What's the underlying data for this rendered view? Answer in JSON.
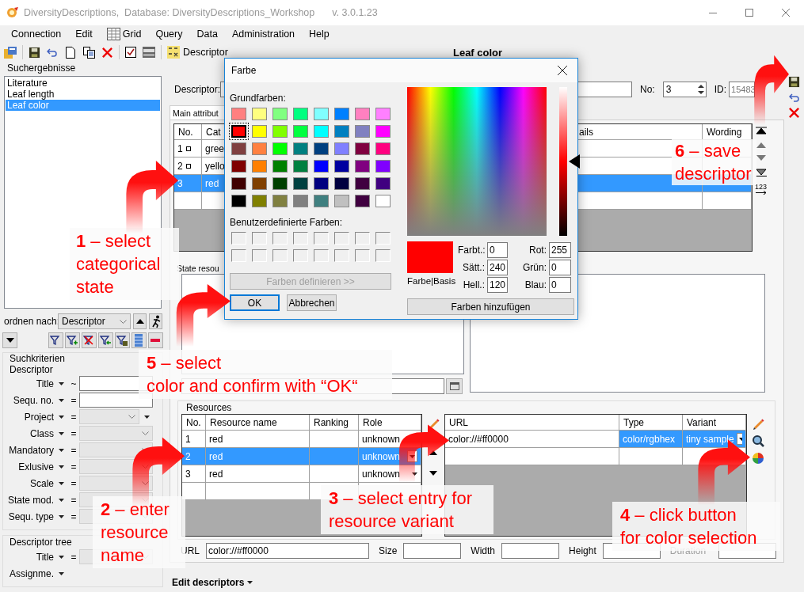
{
  "window": {
    "title": "DiversityDescriptions,  Database: DiversityDescriptions_Workshop",
    "version": "v. 3.0.1.23"
  },
  "menu": [
    {
      "label": "Connection",
      "kind": "plain"
    },
    {
      "label": "Edit",
      "kind": "plain"
    },
    {
      "label": "Grid",
      "kind": "grid"
    },
    {
      "label": "Query",
      "kind": "plain"
    },
    {
      "label": "Data",
      "kind": "plain"
    },
    {
      "label": "Administration",
      "kind": "plain"
    },
    {
      "label": "Help",
      "kind": "plain"
    }
  ],
  "toolbar": {
    "descriptor_button": "Descriptor"
  },
  "page_title": "Leaf color",
  "search_results": {
    "title": "Suchergebnisse",
    "items": [
      {
        "label": "Literature",
        "selected": false
      },
      {
        "label": "Leaf length",
        "selected": false
      },
      {
        "label": "Leaf color",
        "selected": true
      }
    ]
  },
  "sort": {
    "label": "ordnen nach:",
    "value": "Descriptor"
  },
  "search_criteria": {
    "title": "Suchkriterien",
    "group": "Descriptor",
    "rows": [
      {
        "label": "Title",
        "operator": "~",
        "kind": "text"
      },
      {
        "label": "Sequ. no.",
        "operator": "=",
        "kind": "text"
      },
      {
        "label": "Project",
        "operator": "=",
        "kind": "combo-extra"
      },
      {
        "label": "Class",
        "operator": "=",
        "kind": "combo"
      },
      {
        "label": "Mandatory",
        "operator": "=",
        "kind": "combo"
      },
      {
        "label": "Exlusive",
        "operator": "=",
        "kind": "combo"
      },
      {
        "label": "Scale",
        "operator": "=",
        "kind": "combo"
      },
      {
        "label": "State mod.",
        "operator": "=",
        "kind": "combo"
      },
      {
        "label": "Sequ. type",
        "operator": "=",
        "kind": "combo"
      }
    ]
  },
  "descriptor_tree": {
    "title": "Descriptor tree",
    "rows": [
      {
        "label": "Title",
        "operator": "=",
        "kind": "combo"
      },
      {
        "label": "Assignme.",
        "kind": "none"
      }
    ]
  },
  "descriptor": {
    "label": "Descriptor:",
    "no_label": "No:",
    "no": "3",
    "id_label": "ID:",
    "id": "15483"
  },
  "main_tab": {
    "label": "Main attribut",
    "columns": [
      "No.",
      "Cat",
      "ails",
      "Wording"
    ],
    "renumber": "123",
    "rows": [
      {
        "no": "1",
        "marker": true,
        "category": "gree",
        "selected": false
      },
      {
        "no": "2",
        "marker": true,
        "category": "yello",
        "selected": false
      },
      {
        "no": "3",
        "marker": false,
        "category": "red",
        "selected": true
      }
    ]
  },
  "state_resources": {
    "label": "State resou"
  },
  "resources": {
    "title": "Resources",
    "columns": [
      "No.",
      "Resource name",
      "Ranking",
      "Role"
    ],
    "rows": [
      {
        "no": "1",
        "name": "red",
        "role": "unknown",
        "selected": false
      },
      {
        "no": "2",
        "name": "red",
        "role": "unknown",
        "selected": true
      },
      {
        "no": "3",
        "name": "red",
        "role": "unknown",
        "selected": false
      }
    ]
  },
  "variants": {
    "columns": [
      "URL",
      "Type",
      "Variant"
    ],
    "rows": [
      {
        "url": "color://#ff0000",
        "type": "color/rgbhex",
        "variant": "tiny sample",
        "selected": true
      }
    ]
  },
  "details": [
    {
      "label": "URL",
      "value": "color://#ff0000",
      "disabled": false
    },
    {
      "label": "Size",
      "disabled": false
    },
    {
      "label": "Width",
      "disabled": false
    },
    {
      "label": "Height",
      "disabled": false
    },
    {
      "label": "Duration",
      "disabled": true
    }
  ],
  "bottom_tab": {
    "label": "Edit descriptors"
  },
  "color_dialog": {
    "title": "Farbe",
    "basic_label": "Grundfarben:",
    "basic_colors": [
      {
        "color": "#ff8080",
        "selected": false
      },
      {
        "color": "#ffff80",
        "selected": false
      },
      {
        "color": "#80ff80",
        "selected": false
      },
      {
        "color": "#00ff80",
        "selected": false
      },
      {
        "color": "#80ffff",
        "selected": false
      },
      {
        "color": "#0080ff",
        "selected": false
      },
      {
        "color": "#ff80c0",
        "selected": false
      },
      {
        "color": "#ff80ff",
        "selected": false
      },
      {
        "color": "#ff0000",
        "selected": true
      },
      {
        "color": "#ffff00",
        "selected": false
      },
      {
        "color": "#80ff00",
        "selected": false
      },
      {
        "color": "#00ff40",
        "selected": false
      },
      {
        "color": "#00ffff",
        "selected": false
      },
      {
        "color": "#0080c0",
        "selected": false
      },
      {
        "color": "#8080c0",
        "selected": false
      },
      {
        "color": "#ff00ff",
        "selected": false
      },
      {
        "color": "#804040",
        "selected": false
      },
      {
        "color": "#ff8040",
        "selected": false
      },
      {
        "color": "#00ff00",
        "selected": false
      },
      {
        "color": "#008080",
        "selected": false
      },
      {
        "color": "#004080",
        "selected": false
      },
      {
        "color": "#8080ff",
        "selected": false
      },
      {
        "color": "#800040",
        "selected": false
      },
      {
        "color": "#ff0080",
        "selected": false
      },
      {
        "color": "#800000",
        "selected": false
      },
      {
        "color": "#ff8000",
        "selected": false
      },
      {
        "color": "#008000",
        "selected": false
      },
      {
        "color": "#008040",
        "selected": false
      },
      {
        "color": "#0000ff",
        "selected": false
      },
      {
        "color": "#0000a0",
        "selected": false
      },
      {
        "color": "#800080",
        "selected": false
      },
      {
        "color": "#8000ff",
        "selected": false
      },
      {
        "color": "#400000",
        "selected": false
      },
      {
        "color": "#804000",
        "selected": false
      },
      {
        "color": "#004000",
        "selected": false
      },
      {
        "color": "#004040",
        "selected": false
      },
      {
        "color": "#000080",
        "selected": false
      },
      {
        "color": "#000040",
        "selected": false
      },
      {
        "color": "#400040",
        "selected": false
      },
      {
        "color": "#400080",
        "selected": false
      },
      {
        "color": "#000000",
        "selected": false
      },
      {
        "color": "#808000",
        "selected": false
      },
      {
        "color": "#808040",
        "selected": false
      },
      {
        "color": "#808080",
        "selected": false
      },
      {
        "color": "#408080",
        "selected": false
      },
      {
        "color": "#c0c0c0",
        "selected": false
      },
      {
        "color": "#400040",
        "selected": false
      },
      {
        "color": "#ffffff",
        "selected": false
      }
    ],
    "custom_label": "Benutzerdefinierte Farben:",
    "define_button": "Farben definieren >>",
    "ok": "OK",
    "cancel": "Abbrechen",
    "preview_label": "Farbe|Basis",
    "luminance": {
      "level": 0.5
    },
    "fields": [
      {
        "label": "Farbt.:",
        "value": "0"
      },
      {
        "label": "Sätt.:",
        "value": "240"
      },
      {
        "label": "Hell.:",
        "value": "120"
      },
      {
        "label": "Rot:",
        "value": "255"
      },
      {
        "label": "Grün:",
        "value": "0"
      },
      {
        "label": "Blau:",
        "value": "0"
      }
    ],
    "add_button": "Farben hinzufügen"
  },
  "callouts": [
    {
      "text": "**6** – save\ndescriptor"
    },
    {
      "text": "**1** – select\ncategorical\nstate"
    },
    {
      "text": "**5** – select\ncolor and confirm with “OK“"
    },
    {
      "text": "**3** – select entry for\nresource variant"
    },
    {
      "text": "**2** – enter\nresource\nname"
    },
    {
      "text": "**4** – click button\nfor color selection"
    }
  ]
}
